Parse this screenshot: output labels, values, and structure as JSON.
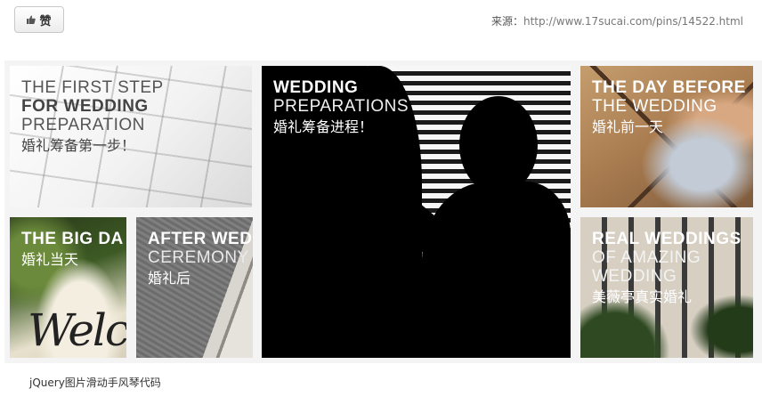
{
  "like_button": {
    "label": "赞",
    "icon": "thumbs-up-icon"
  },
  "source": {
    "prefix": "来源：",
    "url": "http://www.17sucai.com/pins/14522.html"
  },
  "gallery": {
    "panels": [
      {
        "line1": "THE FIRST STEP",
        "line2": "FOR WEDDING",
        "line3": "PREPARATION",
        "cn": "婚礼筹备第一步！"
      },
      {
        "line1": "THE BIG DA",
        "cn": "婚礼当天",
        "script": "Welco"
      },
      {
        "line1": "AFTER WED",
        "line2": "CEREMONY",
        "cn": "婚礼后"
      },
      {
        "line1": "WEDDING",
        "line2": "PREPARATIONS",
        "cn": "婚礼筹备进程！"
      },
      {
        "line1": "THE DAY BEFORE",
        "line2": "THE WEDDING",
        "cn": "婚礼前一天"
      },
      {
        "line1": "REAL WEDDINGS",
        "line2": "OF AMAZING",
        "line3": "WEDDING",
        "cn": "美薇亭真实婚礼"
      }
    ]
  },
  "footer": {
    "link": "jQuery图片滑动手风琴代码"
  }
}
